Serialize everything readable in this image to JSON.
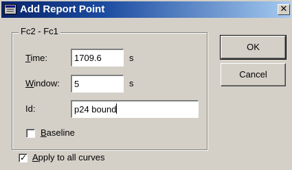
{
  "window": {
    "title": "Add Report Point",
    "close_glyph": "✕"
  },
  "group": {
    "legend": "Fc2 - Fc1"
  },
  "fields": {
    "time": {
      "label_mnemonic": "T",
      "label_rest": "ime:",
      "value": "1709.6",
      "unit": "s"
    },
    "window": {
      "label_mnemonic": "W",
      "label_rest": "indow:",
      "value": "5",
      "unit": "s"
    },
    "id": {
      "label": "Id:",
      "value": "p24 bound"
    }
  },
  "checkboxes": {
    "baseline": {
      "label_mnemonic": "B",
      "label_rest": "aseline",
      "checked": false
    },
    "apply_all": {
      "label_mnemonic": "A",
      "label_rest": "pply to all curves",
      "checked": true
    }
  },
  "buttons": {
    "ok": "OK",
    "cancel": "Cancel"
  },
  "icons": {
    "title_icon": "report-window-icon",
    "close_icon": "close-icon"
  }
}
